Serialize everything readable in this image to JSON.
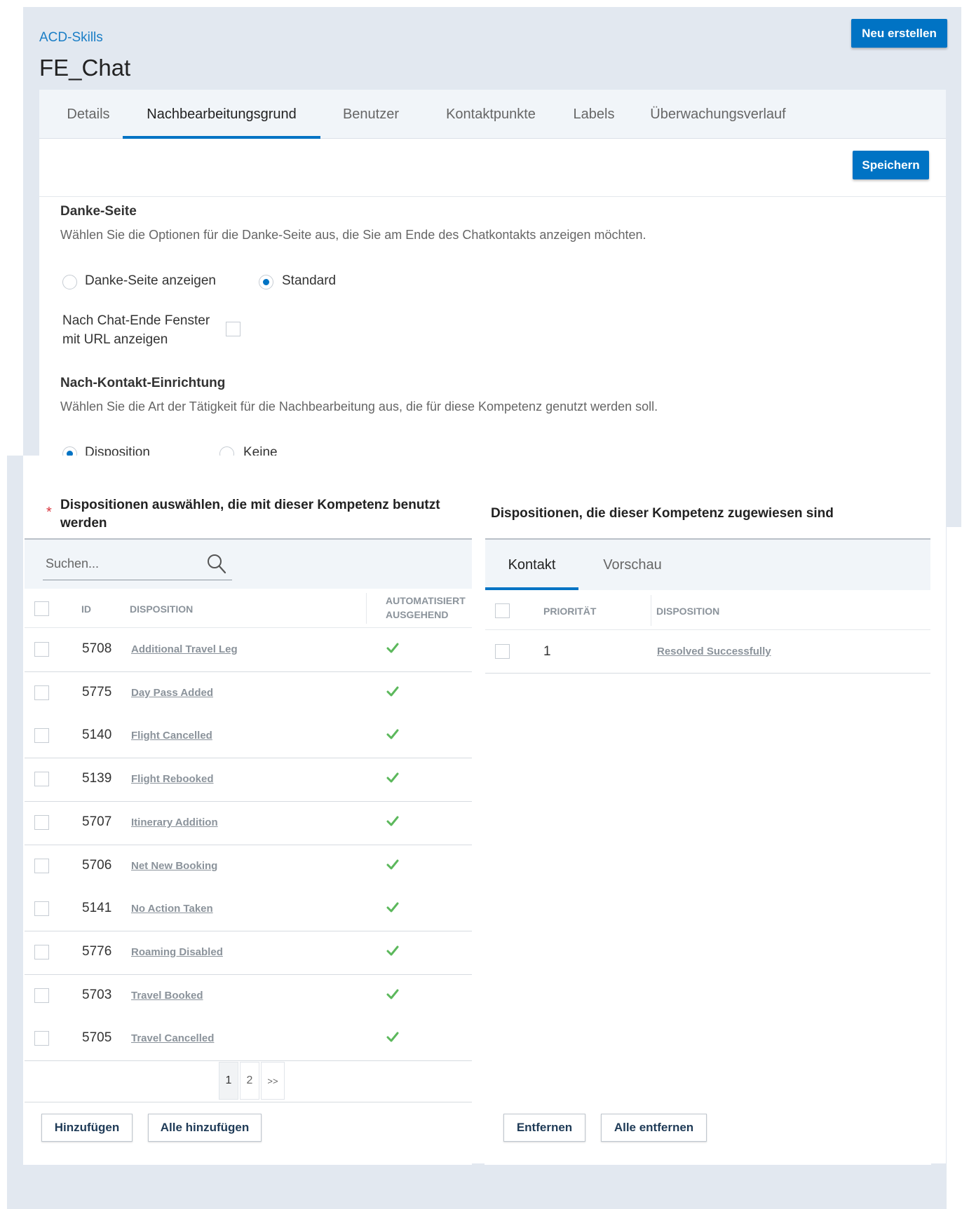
{
  "header": {
    "breadcrumb": "ACD-Skills",
    "title": "FE_Chat",
    "new_button": "Neu erstellen"
  },
  "tabs": [
    {
      "label": "Details",
      "active": false
    },
    {
      "label": "Nachbearbeitungsgrund",
      "active": true
    },
    {
      "label": "Benutzer",
      "active": false
    },
    {
      "label": "Kontaktpunkte",
      "active": false
    },
    {
      "label": "Labels",
      "active": false
    },
    {
      "label": "Überwachungsverlauf",
      "active": false
    }
  ],
  "save_button": "Speichern",
  "thank_you": {
    "title": "Danke-Seite",
    "description": "Wählen Sie die Optionen für die Danke-Seite aus, die Sie am Ende des Chatkontakts anzeigen möchten.",
    "option_show": "Danke-Seite anzeigen",
    "option_standard": "Standard",
    "selected": "Standard",
    "url_window_label_line1": "Nach Chat-Ende Fenster",
    "url_window_label_line2": "mit URL anzeigen",
    "url_window_checked": false
  },
  "post_contact": {
    "title": "Nach-Kontakt-Einrichtung",
    "description": "Wählen Sie die Art der Tätigkeit für die Nachbearbeitung aus, die für diese Kompetenz genutzt werden soll.",
    "option_disposition": "Disposition",
    "option_none": "Keine",
    "selected": "Disposition"
  },
  "left_panel": {
    "required_marker": "*",
    "title_line1": "Dispositionen auswählen, die mit dieser Kompetenz benutzt",
    "title_line2": "werden",
    "search_placeholder": "Suchen...",
    "columns": {
      "id": "ID",
      "disposition": "DISPOSITION",
      "auto_line1": "AUTOMATISIERT",
      "auto_line2": "AUSGEHEND"
    },
    "rows": [
      {
        "id": "5708",
        "name": "Additional Travel Leg",
        "automated": true
      },
      {
        "id": "5775",
        "name": "Day Pass Added",
        "automated": true
      },
      {
        "id": "5140",
        "name": "Flight Cancelled",
        "automated": true
      },
      {
        "id": "5139",
        "name": "Flight Rebooked",
        "automated": true
      },
      {
        "id": "5707",
        "name": "Itinerary Addition",
        "automated": true
      },
      {
        "id": "5706",
        "name": "Net New Booking",
        "automated": true
      },
      {
        "id": "5141",
        "name": "No Action Taken",
        "automated": true
      },
      {
        "id": "5776",
        "name": "Roaming Disabled",
        "automated": true
      },
      {
        "id": "5703",
        "name": "Travel Booked",
        "automated": true
      },
      {
        "id": "5705",
        "name": "Travel Cancelled",
        "automated": true
      }
    ],
    "pagination": {
      "pages": [
        "1",
        "2"
      ],
      "current": "1",
      "next": ">>"
    },
    "add_button": "Hinzufügen",
    "add_all_button": "Alle hinzufügen"
  },
  "right_panel": {
    "title": "Dispositionen, die dieser Kompetenz zugewiesen sind",
    "tabs": [
      {
        "label": "Kontakt",
        "active": true
      },
      {
        "label": "Vorschau",
        "active": false
      }
    ],
    "columns": {
      "priority": "PRIORITÄT",
      "disposition": "DISPOSITION"
    },
    "rows": [
      {
        "priority": "1",
        "name": "Resolved Successfully"
      }
    ],
    "remove_button": "Entfernen",
    "remove_all_button": "Alle entfernen"
  },
  "colors": {
    "accent": "#0073c4",
    "check": "#5cb85c",
    "required": "#d9363e"
  },
  "icons": {
    "search": "search-icon",
    "check": "check-icon"
  }
}
